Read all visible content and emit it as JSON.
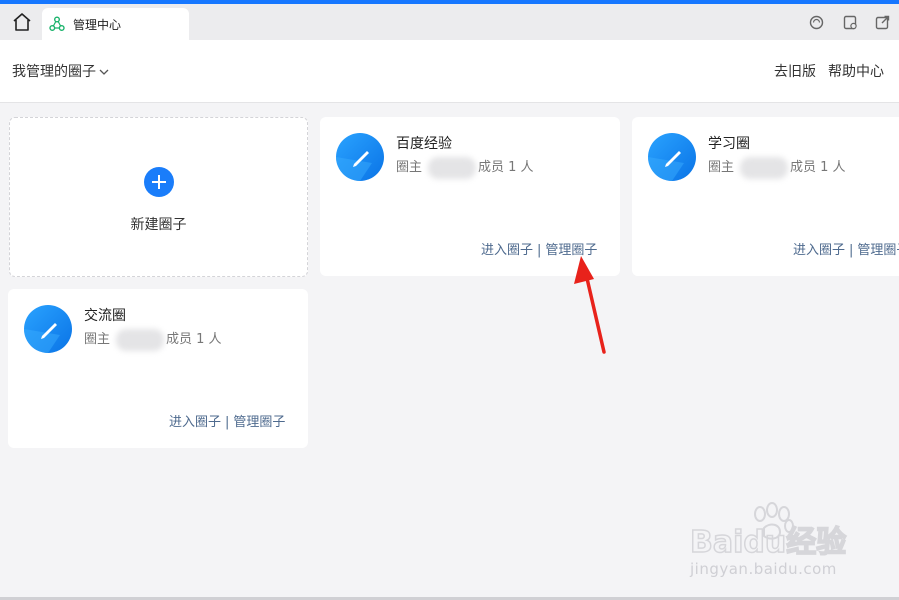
{
  "browser": {
    "tab_title": "管理中心"
  },
  "header": {
    "circle_selector": "我管理的圈子",
    "links": {
      "old_version": "去旧版",
      "help": "帮助中心"
    }
  },
  "new_circle": {
    "label": "新建圈子"
  },
  "circles": [
    {
      "name": "百度经验",
      "owner_label": "圈主",
      "members": "成员 1 人",
      "enter": "进入圈子",
      "separator": "|",
      "manage": "管理圈子"
    },
    {
      "name": "学习圈",
      "owner_label": "圈主",
      "members": "成员 1 人",
      "enter": "进入圈子",
      "separator": "|",
      "manage": "管理圈子"
    },
    {
      "name": "交流圈",
      "owner_label": "圈主",
      "members": "成员 1 人",
      "enter": "进入圈子",
      "separator": "|",
      "manage": "管理圈子"
    }
  ],
  "icons": {
    "home": "home-icon",
    "tab": "circle-app-icon",
    "refresh": "refresh-icon",
    "window": "window-icon",
    "external": "external-link-icon",
    "avatar": "pencil-avatar-icon",
    "add": "plus-icon"
  },
  "colors": {
    "accent": "#1677ff",
    "link": "#4e6a8e",
    "annotation_arrow": "#e8221b"
  },
  "watermark": {
    "brand": "Baidu经验",
    "url": "jingyan.baidu.com"
  }
}
